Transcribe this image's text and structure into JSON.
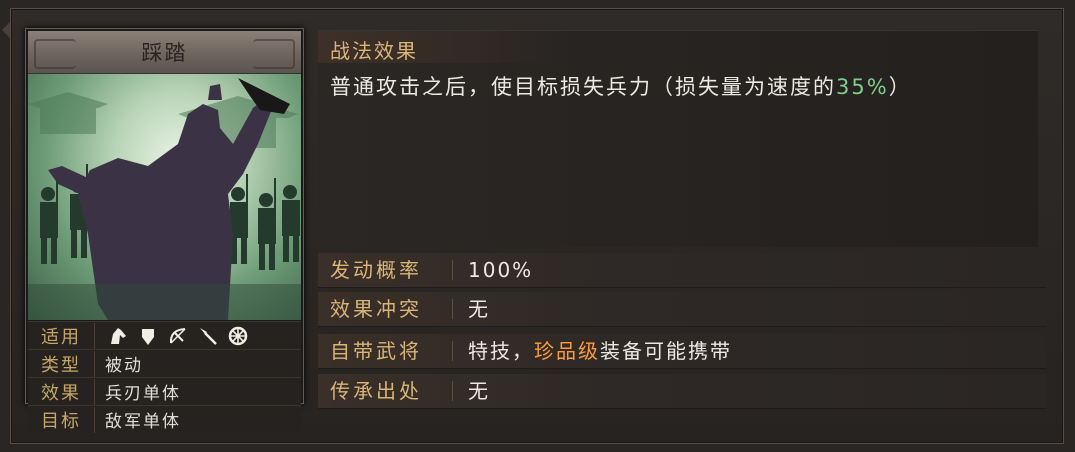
{
  "skill": {
    "name": "踩踏",
    "rows": [
      {
        "key": "适用",
        "type": "icons"
      },
      {
        "key": "类型",
        "value": "被动"
      },
      {
        "key": "效果",
        "value": "兵刃单体"
      },
      {
        "key": "目标",
        "value": "敌军单体"
      }
    ],
    "applicable_icons": [
      "cavalry-icon",
      "shield-icon",
      "bow-icon",
      "spear-icon",
      "siege-icon"
    ]
  },
  "effect": {
    "header": "战法效果",
    "text_main": "普通攻击之后，使目标损失兵力（损失量为速度的",
    "text_value": "35%",
    "text_end": "）"
  },
  "attributes": {
    "trigger_label": "发动概率",
    "trigger_value": "100%",
    "conflict_label": "效果冲突",
    "conflict_value": "无",
    "general_label": "自带武将",
    "general_prefix": "特技，",
    "general_highlight": "珍品级",
    "general_suffix": "装备可能携带",
    "inherit_label": "传承出处",
    "inherit_value": "无"
  },
  "colors": {
    "accent_gold": "#d9b577",
    "value_green": "#7fcf8a",
    "rarity_orange": "#ff9a3c"
  }
}
